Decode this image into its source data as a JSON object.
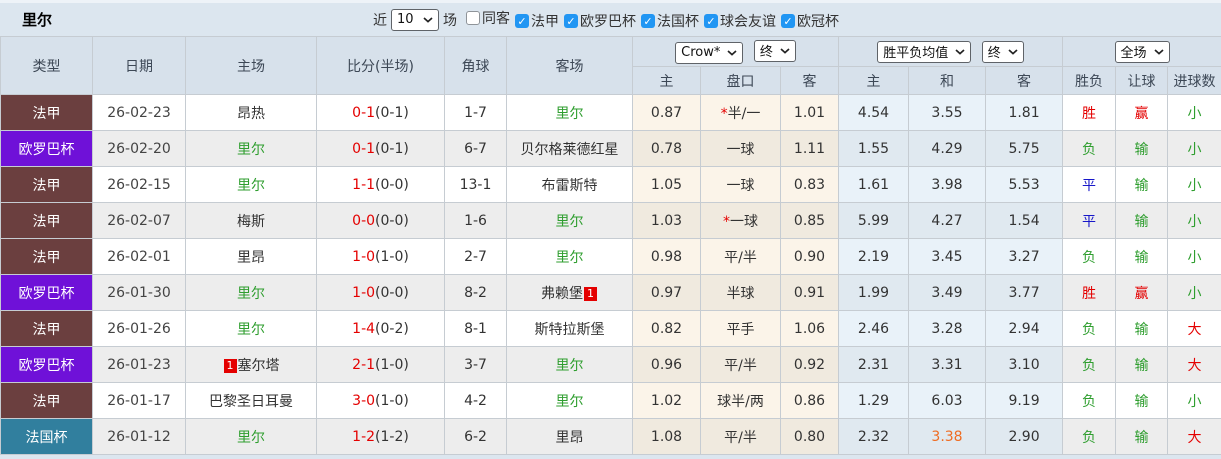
{
  "topbar": {
    "title": "里尔",
    "recent_label": "近",
    "recent_value": "10",
    "matches_label": "场",
    "checkboxes": [
      {
        "label": "同客",
        "checked": false
      },
      {
        "label": "法甲",
        "checked": true
      },
      {
        "label": "欧罗巴杯",
        "checked": true
      },
      {
        "label": "法国杯",
        "checked": true
      },
      {
        "label": "球会友谊",
        "checked": true
      },
      {
        "label": "欧冠杯",
        "checked": true
      }
    ]
  },
  "header": {
    "selects": {
      "company": "Crow*",
      "company_time": "终",
      "mean": "胜平负均值",
      "mean_time": "终",
      "scope": "全场"
    },
    "columns": [
      "类型",
      "日期",
      "主场",
      "比分(半场)",
      "角球",
      "客场",
      "主",
      "盘口",
      "客",
      "主",
      "和",
      "客",
      "胜负",
      "让球",
      "进球数"
    ]
  },
  "colors": {
    "league": {
      "法甲": "#6b3f3f",
      "欧罗巴杯": "#6f11d8",
      "法国杯": "#317f9e"
    },
    "checkbox_on": "#2196f3",
    "score_red": "#e40000",
    "team_green": "#2f9e2f",
    "draw_blue": "#1717c9",
    "hot_orange": "#ef6c22"
  },
  "rows": [
    {
      "league": "法甲",
      "date": "26-02-23",
      "home": {
        "name": "昂热",
        "lille": false,
        "card": "",
        "card_pos": ""
      },
      "score": {
        "full": "0-1",
        "half": "(0-1)"
      },
      "corners": "1-7",
      "away": {
        "name": "里尔",
        "lille": true,
        "card": "",
        "card_pos": ""
      },
      "odds": {
        "home": "0.87",
        "star": true,
        "handicap": "半/一",
        "away": "1.01"
      },
      "mean": {
        "home": "4.54",
        "draw": "3.55",
        "away": "1.81",
        "draw_color": ""
      },
      "result": {
        "outcome": "胜",
        "outcome_color": "red",
        "handicap": "赢",
        "handicap_color": "red",
        "goals": "小",
        "goals_color": "green"
      }
    },
    {
      "league": "欧罗巴杯",
      "date": "26-02-20",
      "home": {
        "name": "里尔",
        "lille": true,
        "card": "",
        "card_pos": ""
      },
      "score": {
        "full": "0-1",
        "half": "(0-1)"
      },
      "corners": "6-7",
      "away": {
        "name": "贝尔格莱德红星",
        "lille": false,
        "card": "",
        "card_pos": ""
      },
      "odds": {
        "home": "0.78",
        "star": false,
        "handicap": "一球",
        "away": "1.11"
      },
      "mean": {
        "home": "1.55",
        "draw": "4.29",
        "away": "5.75",
        "draw_color": ""
      },
      "result": {
        "outcome": "负",
        "outcome_color": "green",
        "handicap": "输",
        "handicap_color": "green",
        "goals": "小",
        "goals_color": "green"
      }
    },
    {
      "league": "法甲",
      "date": "26-02-15",
      "home": {
        "name": "里尔",
        "lille": true,
        "card": "",
        "card_pos": ""
      },
      "score": {
        "full": "1-1",
        "half": "(0-0)"
      },
      "corners": "13-1",
      "away": {
        "name": "布雷斯特",
        "lille": false,
        "card": "",
        "card_pos": ""
      },
      "odds": {
        "home": "1.05",
        "star": false,
        "handicap": "一球",
        "away": "0.83"
      },
      "mean": {
        "home": "1.61",
        "draw": "3.98",
        "away": "5.53",
        "draw_color": ""
      },
      "result": {
        "outcome": "平",
        "outcome_color": "blue",
        "handicap": "输",
        "handicap_color": "green",
        "goals": "小",
        "goals_color": "green"
      }
    },
    {
      "league": "法甲",
      "date": "26-02-07",
      "home": {
        "name": "梅斯",
        "lille": false,
        "card": "",
        "card_pos": ""
      },
      "score": {
        "full": "0-0",
        "half": "(0-0)"
      },
      "corners": "1-6",
      "away": {
        "name": "里尔",
        "lille": true,
        "card": "",
        "card_pos": ""
      },
      "odds": {
        "home": "1.03",
        "star": true,
        "handicap": "一球",
        "away": "0.85"
      },
      "mean": {
        "home": "5.99",
        "draw": "4.27",
        "away": "1.54",
        "draw_color": ""
      },
      "result": {
        "outcome": "平",
        "outcome_color": "blue",
        "handicap": "输",
        "handicap_color": "green",
        "goals": "小",
        "goals_color": "green"
      }
    },
    {
      "league": "法甲",
      "date": "26-02-01",
      "home": {
        "name": "里昂",
        "lille": false,
        "card": "",
        "card_pos": ""
      },
      "score": {
        "full": "1-0",
        "half": "(1-0)"
      },
      "corners": "2-7",
      "away": {
        "name": "里尔",
        "lille": true,
        "card": "",
        "card_pos": ""
      },
      "odds": {
        "home": "0.98",
        "star": false,
        "handicap": "平/半",
        "away": "0.90"
      },
      "mean": {
        "home": "2.19",
        "draw": "3.45",
        "away": "3.27",
        "draw_color": ""
      },
      "result": {
        "outcome": "负",
        "outcome_color": "green",
        "handicap": "输",
        "handicap_color": "green",
        "goals": "小",
        "goals_color": "green"
      }
    },
    {
      "league": "欧罗巴杯",
      "date": "26-01-30",
      "home": {
        "name": "里尔",
        "lille": true,
        "card": "",
        "card_pos": ""
      },
      "score": {
        "full": "1-0",
        "half": "(0-0)"
      },
      "corners": "8-2",
      "away": {
        "name": "弗赖堡",
        "lille": false,
        "card": "1",
        "card_pos": "after"
      },
      "odds": {
        "home": "0.97",
        "star": false,
        "handicap": "半球",
        "away": "0.91"
      },
      "mean": {
        "home": "1.99",
        "draw": "3.49",
        "away": "3.77",
        "draw_color": ""
      },
      "result": {
        "outcome": "胜",
        "outcome_color": "red",
        "handicap": "赢",
        "handicap_color": "red",
        "goals": "小",
        "goals_color": "green"
      }
    },
    {
      "league": "法甲",
      "date": "26-01-26",
      "home": {
        "name": "里尔",
        "lille": true,
        "card": "",
        "card_pos": ""
      },
      "score": {
        "full": "1-4",
        "half": "(0-2)"
      },
      "corners": "8-1",
      "away": {
        "name": "斯特拉斯堡",
        "lille": false,
        "card": "",
        "card_pos": ""
      },
      "odds": {
        "home": "0.82",
        "star": false,
        "handicap": "平手",
        "away": "1.06"
      },
      "mean": {
        "home": "2.46",
        "draw": "3.28",
        "away": "2.94",
        "draw_color": ""
      },
      "result": {
        "outcome": "负",
        "outcome_color": "green",
        "handicap": "输",
        "handicap_color": "green",
        "goals": "大",
        "goals_color": "red"
      }
    },
    {
      "league": "欧罗巴杯",
      "date": "26-01-23",
      "home": {
        "name": "塞尔塔",
        "lille": false,
        "card": "1",
        "card_pos": "before"
      },
      "score": {
        "full": "2-1",
        "half": "(1-0)"
      },
      "corners": "3-7",
      "away": {
        "name": "里尔",
        "lille": true,
        "card": "",
        "card_pos": ""
      },
      "odds": {
        "home": "0.96",
        "star": false,
        "handicap": "平/半",
        "away": "0.92"
      },
      "mean": {
        "home": "2.31",
        "draw": "3.31",
        "away": "3.10",
        "draw_color": ""
      },
      "result": {
        "outcome": "负",
        "outcome_color": "green",
        "handicap": "输",
        "handicap_color": "green",
        "goals": "大",
        "goals_color": "red"
      }
    },
    {
      "league": "法甲",
      "date": "26-01-17",
      "home": {
        "name": "巴黎圣日耳曼",
        "lille": false,
        "card": "",
        "card_pos": ""
      },
      "score": {
        "full": "3-0",
        "half": "(1-0)"
      },
      "corners": "4-2",
      "away": {
        "name": "里尔",
        "lille": true,
        "card": "",
        "card_pos": ""
      },
      "odds": {
        "home": "1.02",
        "star": false,
        "handicap": "球半/两",
        "away": "0.86"
      },
      "mean": {
        "home": "1.29",
        "draw": "6.03",
        "away": "9.19",
        "draw_color": ""
      },
      "result": {
        "outcome": "负",
        "outcome_color": "green",
        "handicap": "输",
        "handicap_color": "green",
        "goals": "小",
        "goals_color": "green"
      }
    },
    {
      "league": "法国杯",
      "date": "26-01-12",
      "home": {
        "name": "里尔",
        "lille": true,
        "card": "",
        "card_pos": ""
      },
      "score": {
        "full": "1-2",
        "half": "(1-2)"
      },
      "corners": "6-2",
      "away": {
        "name": "里昂",
        "lille": false,
        "card": "",
        "card_pos": ""
      },
      "odds": {
        "home": "1.08",
        "star": false,
        "handicap": "平/半",
        "away": "0.80"
      },
      "mean": {
        "home": "2.32",
        "draw": "3.38",
        "away": "2.90",
        "draw_color": "orange"
      },
      "result": {
        "outcome": "负",
        "outcome_color": "green",
        "handicap": "输",
        "handicap_color": "green",
        "goals": "大",
        "goals_color": "red"
      }
    }
  ]
}
